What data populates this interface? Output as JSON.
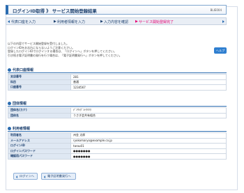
{
  "header": {
    "title": "ログインID取得 》 サービス開始登録結果",
    "screen_code": "BLIE004"
  },
  "steps": {
    "items": [
      "代表口座を入力",
      "利用者情報を入力",
      "入力内容を確認",
      "サービス開始登録完了"
    ],
    "current_index": 3
  },
  "intro": {
    "lines": [
      "以下の内容でサービス開始登録を受付しました。",
      "ログインIDをお忘れにならないようご注意ください。",
      "登録したログインIDでログインする場合は、「ログインへ」ボタンを押してください。",
      "引き続き電子証明書の発行を行う場合は、「電子証明書発行へ」ボタンを押してください。"
    ]
  },
  "help_label": "ヘルプ",
  "sections": {
    "account": {
      "title": "代表口座情報",
      "rows": [
        {
          "label": "支店番号",
          "value": "281"
        },
        {
          "label": "科目",
          "value": "普通"
        },
        {
          "label": "口座番号",
          "value": "1234567"
        }
      ]
    },
    "group": {
      "title": "団体情報",
      "rows": [
        {
          "label": "団体名(カナ)",
          "value": "ﾃﾞﾝｻｲｸﾞﾝﾄｳﾘﾂｸ"
        },
        {
          "label": "団体名",
          "value": "うさぎ会共有組合"
        }
      ]
    },
    "user": {
      "title": "利用者情報",
      "rows": [
        {
          "label": "利用者名",
          "value": "州金 太郎"
        },
        {
          "label": "メールアドレス",
          "value": "ryokomaryo@example.co.jp"
        },
        {
          "label": "ログインID",
          "value": "tarou01"
        },
        {
          "label": "ログインパスワード",
          "value": "●●●●●●●"
        },
        {
          "label": "確認用パスワード",
          "value": "●●●●●●●"
        }
      ]
    }
  },
  "buttons": {
    "login": "ログインへ",
    "certificate": "電子証明書発行へ"
  }
}
